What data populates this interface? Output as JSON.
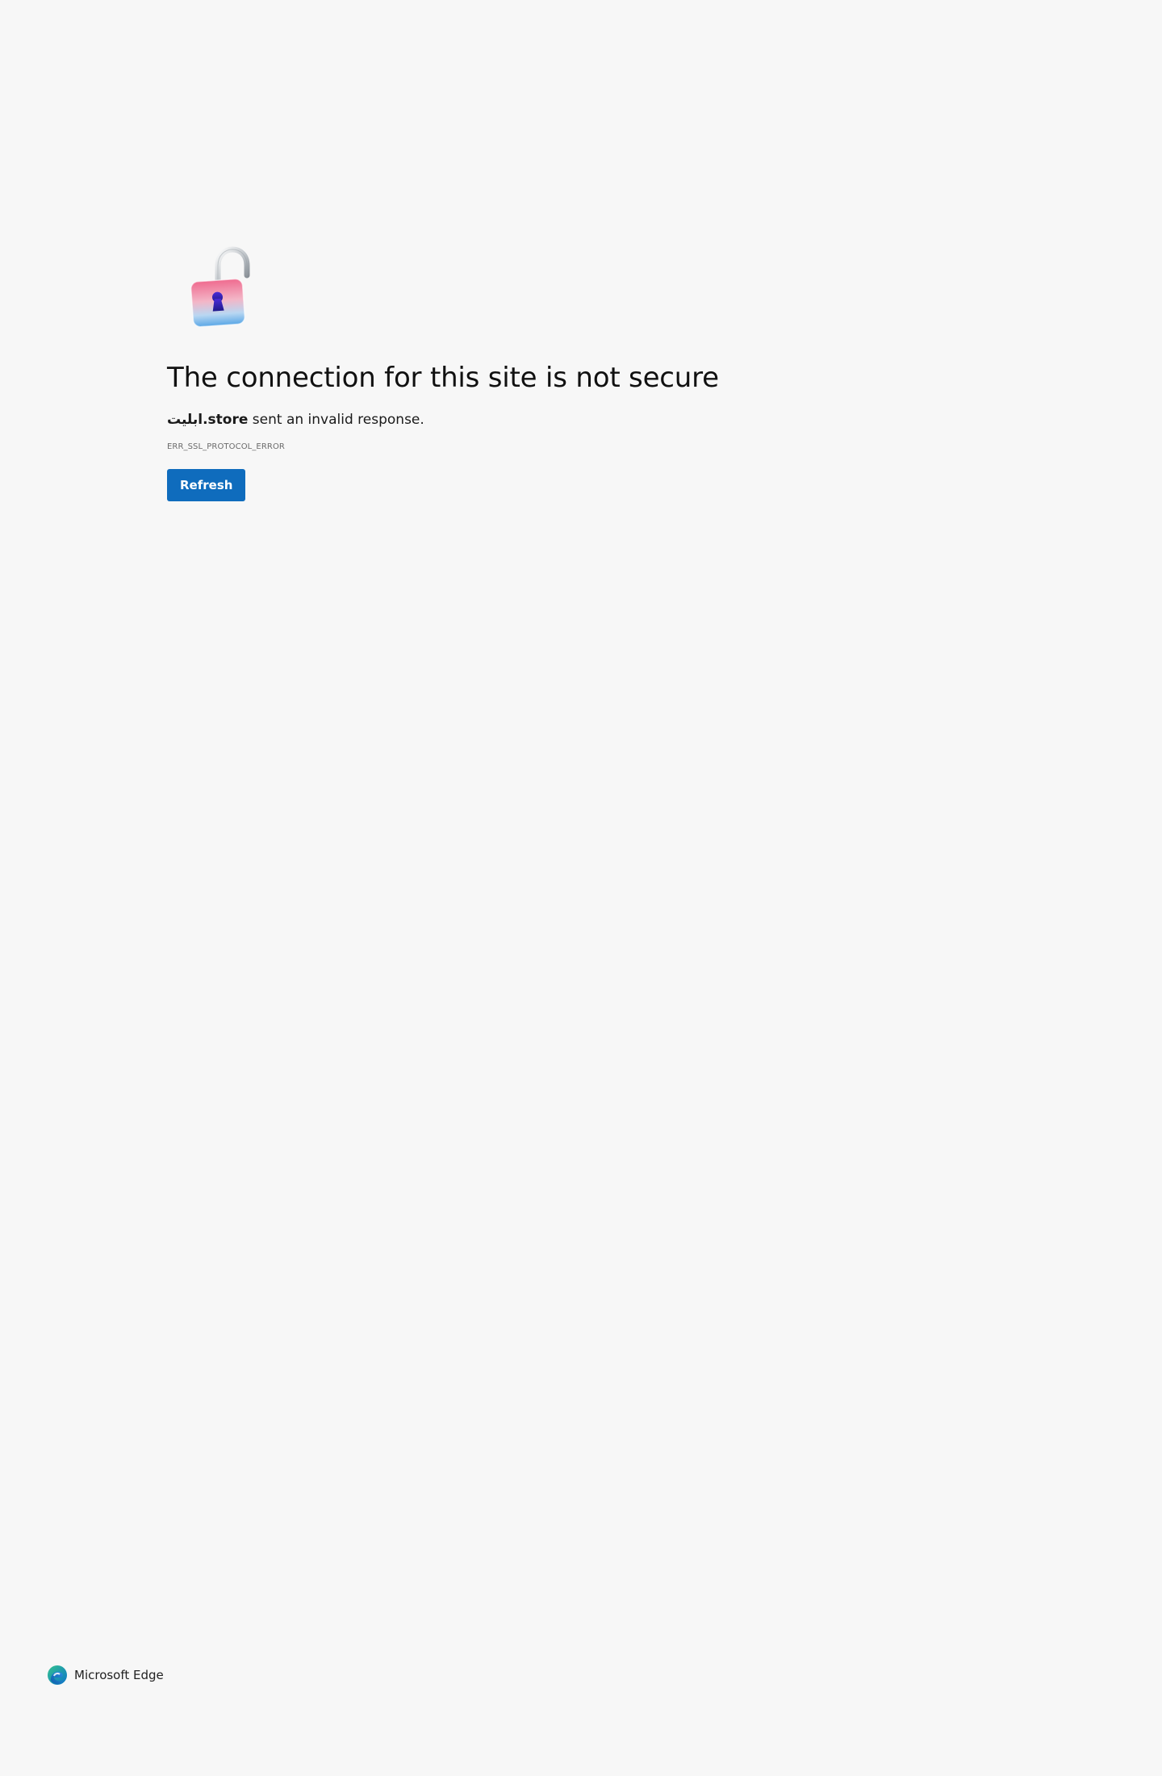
{
  "main": {
    "lock_icon": "unlocked-padlock-icon",
    "title": "The connection for this site is not secure",
    "message_host": "ابلیت.store",
    "message_suffix": " sent an invalid response.",
    "error_code": "ERR_SSL_PROTOCOL_ERROR",
    "refresh_label": "Refresh"
  },
  "footer": {
    "brand_icon": "microsoft-edge-logo-icon",
    "brand_name": "Microsoft Edge"
  },
  "colors": {
    "background": "#f7f7f7",
    "button": "#0f6cbd",
    "button_text": "#ffffff"
  }
}
